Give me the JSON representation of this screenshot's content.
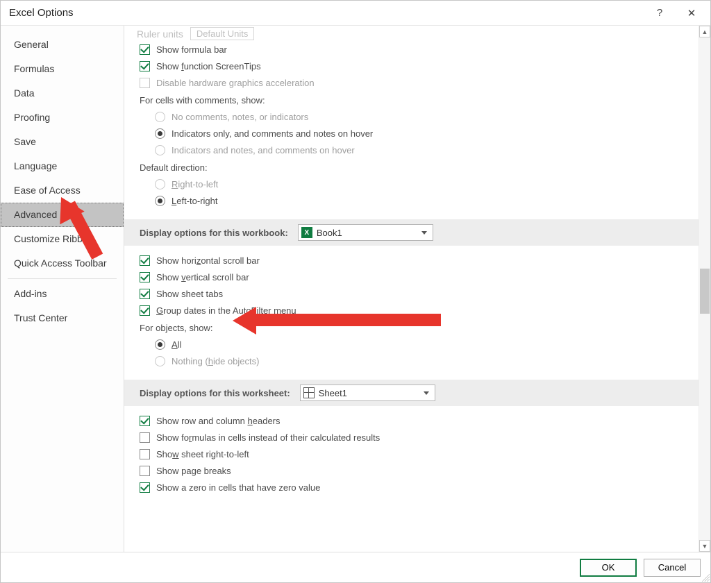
{
  "window": {
    "title": "Excel Options"
  },
  "sidebar": {
    "items": [
      {
        "label": "General"
      },
      {
        "label": "Formulas"
      },
      {
        "label": "Data"
      },
      {
        "label": "Proofing"
      },
      {
        "label": "Save"
      },
      {
        "label": "Language"
      },
      {
        "label": "Ease of Access"
      },
      {
        "label": "Advanced",
        "selected": true
      },
      {
        "label": "Customize Ribbon"
      },
      {
        "label": "Quick Access Toolbar"
      },
      {
        "label": "Add-ins"
      },
      {
        "label": "Trust Center"
      }
    ]
  },
  "truncated": {
    "label": "Ruler units",
    "dropdown": "Default Units"
  },
  "display_top": {
    "formula_bar": "Show formula bar",
    "screentips_pre": "Show ",
    "screentips_u": "f",
    "screentips_post": "unction ScreenTips",
    "disable_hw": "Disable hardware graphics acceleration",
    "comments_heading": "For cells with comments, show:",
    "r1": "No comments, notes, or indicators",
    "r2": "Indicators only, and comments and notes on hover",
    "r3": "Indicators and notes, and comments on hover",
    "direction_heading": "Default direction:",
    "rtl_u": "R",
    "rtl_post": "ight-to-left",
    "ltr_u": "L",
    "ltr_post": "eft-to-right"
  },
  "workbook_section": {
    "title_pre": "Display options for this workboo",
    "title_u": "k",
    "title_post": ":",
    "selected": "Book1",
    "h_scroll_pre": "Show hori",
    "h_scroll_u": "z",
    "h_scroll_post": "ontal scroll bar",
    "v_scroll_pre": "Show ",
    "v_scroll_u": "v",
    "v_scroll_post": "ertical scroll bar",
    "tabs": "Show sheet tabs",
    "group_pre": "",
    "group_u": "G",
    "group_post": "roup dates in the AutoFilter menu",
    "objects_heading": "For objects, show:",
    "all_u": "A",
    "all_post": "ll",
    "nothing_pre": "Nothing (",
    "nothing_u": "h",
    "nothing_post": "ide objects)"
  },
  "worksheet_section": {
    "title": "Display options for this worksheet:",
    "selected": "Sheet1",
    "head_pre": "Show row and column ",
    "head_u": "h",
    "head_post": "eaders",
    "formulas_pre": "Show fo",
    "formulas_u": "r",
    "formulas_post": "mulas in cells instead of their calculated results",
    "rtl_pre": "Sho",
    "rtl_u": "w",
    "rtl_post": " sheet right-to-left",
    "breaks": "Show page breaks",
    "zero": "Show a zero in cells that have zero value"
  },
  "footer": {
    "ok": "OK",
    "cancel": "Cancel"
  }
}
